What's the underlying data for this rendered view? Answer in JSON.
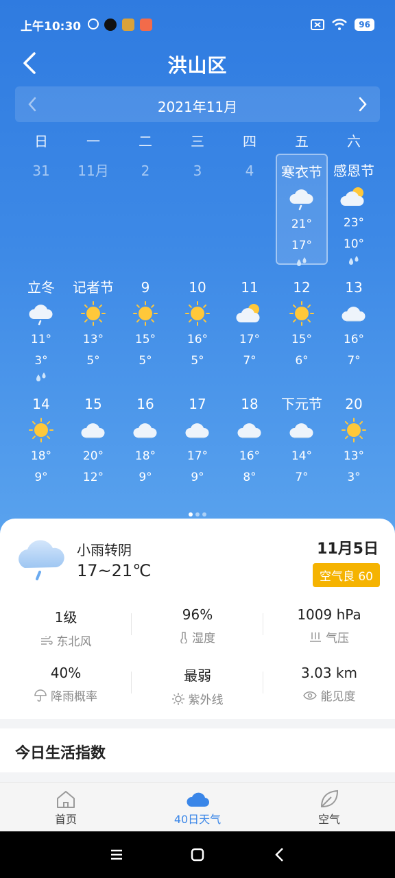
{
  "status": {
    "time": "上午10:30",
    "battery": "96"
  },
  "header": {
    "title": "洪山区"
  },
  "month": {
    "label": "2021年11月"
  },
  "weekdays": [
    "日",
    "一",
    "二",
    "三",
    "四",
    "五",
    "六"
  ],
  "days": [
    {
      "label": "31",
      "dim": true
    },
    {
      "label": "11月",
      "dim": true
    },
    {
      "label": "2",
      "dim": true
    },
    {
      "label": "3",
      "dim": true
    },
    {
      "label": "4",
      "dim": true
    },
    {
      "label": "寒衣节",
      "icon": "rain-cloud",
      "hi": "21°",
      "lo": "17°",
      "rain": true,
      "selected": true
    },
    {
      "label": "感恩节",
      "icon": "partly-cloudy",
      "hi": "23°",
      "lo": "10°",
      "rain": true
    },
    {
      "label": "立冬",
      "icon": "rain-cloud",
      "hi": "11°",
      "lo": "3°",
      "rain": true
    },
    {
      "label": "记者节",
      "icon": "sun",
      "hi": "13°",
      "lo": "5°"
    },
    {
      "label": "9",
      "icon": "sun",
      "hi": "15°",
      "lo": "5°"
    },
    {
      "label": "10",
      "icon": "sun",
      "hi": "16°",
      "lo": "5°"
    },
    {
      "label": "11",
      "icon": "partly-cloudy",
      "hi": "17°",
      "lo": "7°"
    },
    {
      "label": "12",
      "icon": "sun",
      "hi": "15°",
      "lo": "6°"
    },
    {
      "label": "13",
      "icon": "cloud",
      "hi": "16°",
      "lo": "7°"
    },
    {
      "label": "14",
      "icon": "sun",
      "hi": "18°",
      "lo": "9°"
    },
    {
      "label": "15",
      "icon": "cloud",
      "hi": "20°",
      "lo": "12°"
    },
    {
      "label": "16",
      "icon": "cloud",
      "hi": "18°",
      "lo": "9°"
    },
    {
      "label": "17",
      "icon": "cloud",
      "hi": "17°",
      "lo": "9°"
    },
    {
      "label": "18",
      "icon": "cloud",
      "hi": "16°",
      "lo": "8°"
    },
    {
      "label": "下元节",
      "icon": "cloud",
      "hi": "14°",
      "lo": "7°"
    },
    {
      "label": "20",
      "icon": "sun",
      "hi": "13°",
      "lo": "3°"
    }
  ],
  "detail": {
    "weather": "小雨转阴",
    "temp": "17~21℃",
    "date": "11月5日",
    "aqi": "空气良 60",
    "stats": [
      {
        "value": "1级",
        "label": "东北风",
        "icon": "wind-icon"
      },
      {
        "value": "96%",
        "label": "湿度",
        "icon": "thermometer-icon"
      },
      {
        "value": "1009 hPa",
        "label": "气压",
        "icon": "pressure-icon"
      },
      {
        "value": "40%",
        "label": "降雨概率",
        "icon": "umbrella-icon"
      },
      {
        "value": "最弱",
        "label": "紫外线",
        "icon": "sun-icon"
      },
      {
        "value": "3.03 km",
        "label": "能见度",
        "icon": "eye-icon"
      }
    ]
  },
  "life": {
    "title": "今日生活指数"
  },
  "tabs": [
    {
      "label": "首页",
      "icon": "home-icon"
    },
    {
      "label": "40日天气",
      "icon": "cloud-icon",
      "active": true
    },
    {
      "label": "空气",
      "icon": "leaf-icon"
    }
  ],
  "colors": {
    "accent": "#3a86e8",
    "aqi": "#f5b301",
    "sky_top": "#2f7be0"
  }
}
